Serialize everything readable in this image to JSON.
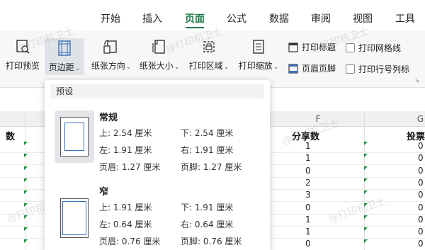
{
  "tabs": [
    "开始",
    "插入",
    "页面",
    "公式",
    "数据",
    "审阅",
    "视图",
    "工具"
  ],
  "ribbon": {
    "print_preview": "打印预览",
    "margins": "页边距",
    "orientation": "纸张方向",
    "paper_size": "纸张大小",
    "print_area": "打印区域",
    "print_scale": "打印缩放",
    "print_titles": "打印标题",
    "header_footer": "页眉页脚",
    "print_gridlines": "打印网格线",
    "print_headings": "打印行号列标"
  },
  "sheet": {
    "col_f": "F",
    "col_g": "G",
    "col_left_header": "数",
    "col_f_header": "分享数",
    "col_g_header": "投票",
    "col_f_values": [
      "1",
      "1",
      "0",
      "2",
      "3",
      "0",
      "1",
      "1",
      "0"
    ],
    "col_g_values": [
      "0",
      "0",
      "0",
      "0",
      "0",
      "0",
      "0",
      "0",
      "0"
    ]
  },
  "panel": {
    "heading": "预设",
    "presets": [
      {
        "name": "常规",
        "top": "上: 2.54 厘米",
        "bottom": "下: 2.54 厘米",
        "left": "左: 1.91 厘米",
        "right": "右: 1.91 厘米",
        "header": "页眉: 1.27 厘米",
        "footer": "页脚: 1.27 厘米"
      },
      {
        "name": "窄",
        "top": "上: 1.91 厘米",
        "bottom": "下: 1.91 厘米",
        "left": "左: 0.64 厘米",
        "right": "右: 0.64 厘米",
        "header": "页眉: 0.76 厘米",
        "footer": "页脚: 0.76 厘米"
      }
    ]
  },
  "watermark": "@打印机卫士",
  "colors": {
    "accent": "#1f7a4a",
    "margin_line": "#3a6fb5",
    "flag": "#1a8a3a"
  }
}
